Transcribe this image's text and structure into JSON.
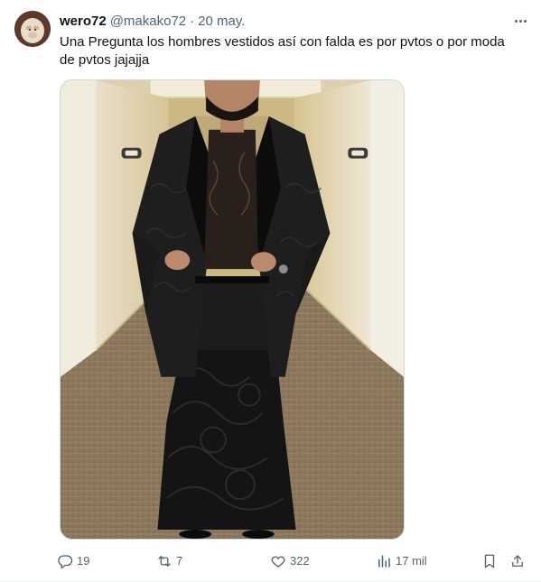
{
  "post": {
    "author_name": "wero72",
    "handle": "@makako72",
    "separator": "·",
    "date": "20 may.",
    "text": "Una Pregunta los hombres vestidos así con falda es por pvtos o por moda de pvtos jajajja"
  },
  "actions": {
    "replies": "19",
    "reposts": "7",
    "likes": "322",
    "views": "17 mil"
  },
  "icons": {
    "more": "more-horizontal-icon",
    "reply": "reply-icon",
    "repost": "repost-icon",
    "like": "heart-icon",
    "views": "views-chart-icon",
    "bookmark": "bookmark-icon",
    "share": "share-icon"
  },
  "colors": {
    "text": "#0f1419",
    "secondary": "#536471",
    "border": "#cfd9de"
  }
}
